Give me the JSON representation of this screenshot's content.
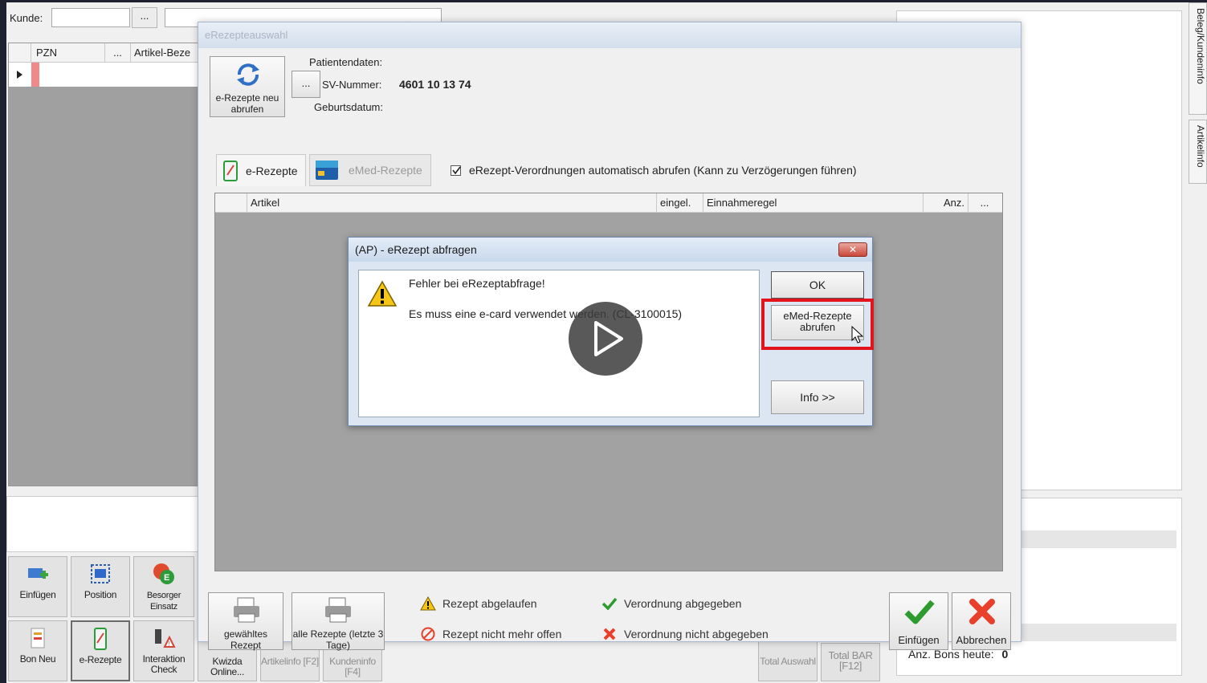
{
  "base": {
    "kunde_label": "Kunde:",
    "dots": "...",
    "grid_headers": [
      "PZN",
      "...",
      "Artikel-Beze"
    ],
    "toolbar_row1": [
      {
        "label": "Einfügen",
        "icon": "add-position-icon"
      },
      {
        "label": "Position",
        "icon": "position-icon"
      },
      {
        "label": "Besorger Einsatz",
        "icon": "besorger-icon"
      }
    ],
    "toolbar_row2": [
      {
        "label": "Bon Neu",
        "icon": "new-receipt-icon"
      },
      {
        "label": "e-Rezepte",
        "icon": "erezept-icon"
      },
      {
        "label": "Interaktion Check",
        "icon": "interaction-check-icon"
      },
      {
        "label": "Kwizda Online...",
        "icon": "kwizda-icon"
      },
      {
        "label": "Artikelinfo [F2]",
        "icon": "article-info-icon"
      },
      {
        "label": "Kundeninfo [F4]",
        "icon": "customer-info-icon"
      },
      {
        "label": "Total Auswahl",
        "icon": "total-select-icon"
      },
      {
        "label": "Total BAR [F12]",
        "icon": "total-cash-icon"
      }
    ],
    "right_tabs": [
      "Beleg/Kundeninfo",
      "Artikelinfo"
    ],
    "bons_label": "Anz. Bons heute:",
    "bons_value": "0"
  },
  "erezept_dialog": {
    "title": "eRezepteauswahl",
    "refresh_button": "e-Rezepte neu abrufen",
    "patient_label": "Patientendaten:",
    "sv_label": "SV-Nummer:",
    "sv_value": "4601 10 13 74",
    "birth_label": "Geburtsdatum:",
    "tabs": [
      {
        "label": "e-Rezepte",
        "active": true
      },
      {
        "label": "eMed-Rezepte",
        "active": false
      }
    ],
    "auto_checkbox": {
      "checked": true,
      "label": "eRezept-Verordnungen automatisch abrufen (Kann zu Verzögerungen führen)"
    },
    "columns": [
      "Artikel",
      "eingel.",
      "Einnahmeregel",
      "Anz.",
      "..."
    ],
    "bottom_buttons": [
      {
        "label": "gewähltes Rezept"
      },
      {
        "label": "alle Rezepte (letzte 3 Tage)"
      }
    ],
    "legend": [
      {
        "label": "Rezept abgelaufen",
        "icon": "warning-icon"
      },
      {
        "label": "Rezept nicht mehr offen",
        "icon": "forbidden-icon"
      },
      {
        "label": "Verordnung abgegeben",
        "icon": "check-icon"
      },
      {
        "label": "Verordnung nicht abgegeben",
        "icon": "cross-icon"
      }
    ],
    "confirm_button": "Einfügen",
    "cancel_button": "Abbrechen"
  },
  "error_modal": {
    "title": "(AP) - eRezept abfragen",
    "close": "✕",
    "heading": "Fehler bei eRezeptabfrage!",
    "message": "Es muss eine e-card verwendet werden. (CL-3100015)",
    "ok_button": "OK",
    "emed_button": "eMed-Rezepte abrufen",
    "info_button": "Info >>"
  },
  "colors": {
    "highlight": "#e3131e",
    "check": "#2e9b2e",
    "cross": "#e8402a"
  }
}
